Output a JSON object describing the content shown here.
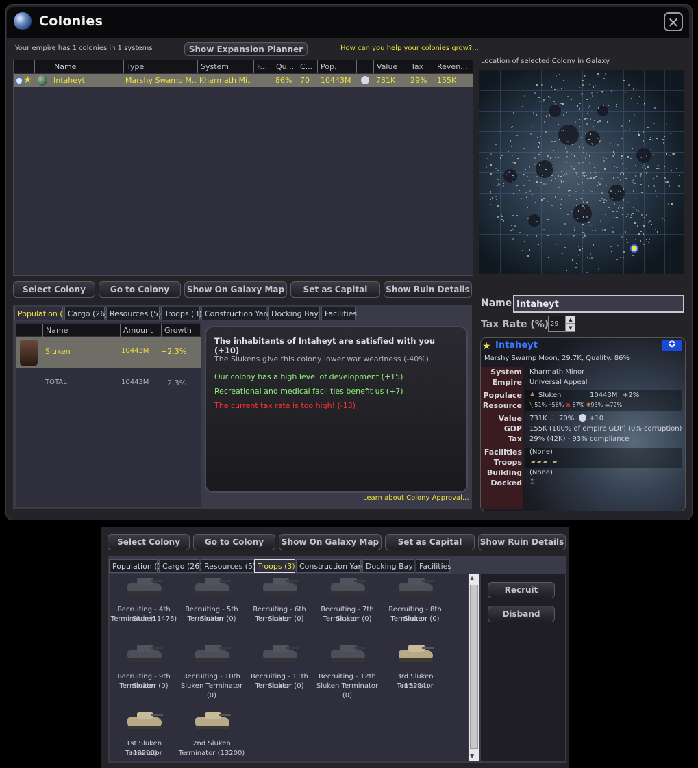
{
  "window": {
    "title": "Colonies",
    "close": "✕"
  },
  "summary": "Your empire has 1 colonies in 1 systems",
  "expansion_button": "Show Expansion Planner",
  "help_link": "How can you help your colonies grow?...",
  "table": {
    "headers": [
      "",
      "",
      "Name",
      "Type",
      "System",
      "F...",
      "Qu...",
      "C...",
      "Pop.",
      "",
      "Value",
      "Tax",
      "Reven..."
    ],
    "rows": [
      {
        "name": "Intaheyt",
        "type": "Marshy Swamp M...",
        "system": "Kharmath Mi...",
        "quality": "86%",
        "c": "70",
        "pop": "10443M",
        "value": "731K",
        "tax": "29%",
        "revenue": "155K"
      }
    ]
  },
  "map_label": "Location of selected Colony in Galaxy",
  "actions": [
    "Select Colony",
    "Go to Colony",
    "Show On Galaxy Map",
    "Set as Capital",
    "Show Ruin Details"
  ],
  "tabs": [
    "Population (1)",
    "Cargo (26)",
    "Resources (5)",
    "Troops (3)",
    "Construction Yard",
    "Docking Bay (1)",
    "Facilities"
  ],
  "population": {
    "headers": [
      "",
      "Name",
      "Amount",
      "Growth"
    ],
    "rows": [
      {
        "name": "Sluken",
        "amount": "10443M",
        "growth": "+2.3%"
      }
    ],
    "total": {
      "name": "TOTAL",
      "amount": "10443M",
      "growth": "+2.3%"
    }
  },
  "approval": {
    "heading": "The inhabitants of Intaheyt are satisfied with you (+10)",
    "line1": "The Slukens give this colony lower war weariness (-40%)",
    "pos1": "Our colony has a high level of development (+15)",
    "pos2": "Recreational and medical facilities benefit us (+7)",
    "neg1": "The current tax rate is too high! (-13)",
    "learn": "Learn about Colony Approval..."
  },
  "name_field": {
    "label": "Name",
    "value": "Intaheyt"
  },
  "tax_field": {
    "label": "Tax Rate (%)",
    "value": "29"
  },
  "info": {
    "name": "Intaheyt",
    "subtitle": "Marshy Swamp Moon, 29.7K,  Quality: 86%",
    "labels": {
      "system": "System",
      "empire": "Empire",
      "populace": "Populace",
      "resource": "Resource",
      "value": "Value",
      "gdp": "GDP",
      "tax": "Tax",
      "facilities": "Facilities",
      "troops": "Troops",
      "building": "Building",
      "docked": "Docked"
    },
    "system": "Kharmath Minor",
    "empire": "Universal Appeal",
    "populace_race": "Sluken",
    "populace_amount": "10443M",
    "populace_growth": "+2%",
    "resources": [
      "51%",
      "56%",
      "67%",
      "93%",
      "72%"
    ],
    "value": "731K",
    "value_pct": "70%",
    "value_approval": "+10",
    "gdp": "155K (100% of empire GDP) (0% corruption)",
    "tax": "29% (42K) - 93% compliance",
    "facilities": "(None)",
    "building": "(None)"
  },
  "lower": {
    "actions": [
      "Select Colony",
      "Go to Colony",
      "Show On Galaxy Map",
      "Set as Capital",
      "Show Ruin Details"
    ],
    "tabs": [
      "Population (1)",
      "Cargo (26)",
      "Resources (5)",
      "Troops (3)",
      "Construction Yard",
      "Docking Bay (1)",
      "Facilities"
    ],
    "recruit": "Recruit",
    "disband": "Disband",
    "troops": [
      {
        "line1": "Recruiting - 4th Sluken",
        "line2": "Terminator (11476)",
        "active": false
      },
      {
        "line1": "Recruiting - 5th Sluken",
        "line2": "Terminator (0)",
        "active": false
      },
      {
        "line1": "Recruiting - 6th Sluken",
        "line2": "Terminator (0)",
        "active": false
      },
      {
        "line1": "Recruiting - 7th Sluken",
        "line2": "Terminator (0)",
        "active": false
      },
      {
        "line1": "Recruiting - 8th Sluken",
        "line2": "Terminator (0)",
        "active": false
      },
      {
        "line1": "Recruiting - 9th Sluken",
        "line2": "Terminator (0)",
        "active": false
      },
      {
        "line1": "Recruiting - 10th",
        "line2": "Sluken Terminator (0)",
        "active": false
      },
      {
        "line1": "Recruiting - 11th Sluken",
        "line2": "Terminator (0)",
        "active": false
      },
      {
        "line1": "Recruiting - 12th",
        "line2": "Sluken Terminator (0)",
        "active": false
      },
      {
        "line1": "3rd Sluken Terminator",
        "line2": "(13284)",
        "active": true
      },
      {
        "line1": "1st Sluken Terminator",
        "line2": "(13200)",
        "active": true
      },
      {
        "line1": "2nd Sluken",
        "line2": "Terminator (13200)",
        "active": true
      }
    ]
  },
  "colors": {
    "accent_yellow": "#f0e040",
    "positive": "#8ef07a",
    "negative": "#ff3030",
    "panel": "#2e2e3c"
  }
}
